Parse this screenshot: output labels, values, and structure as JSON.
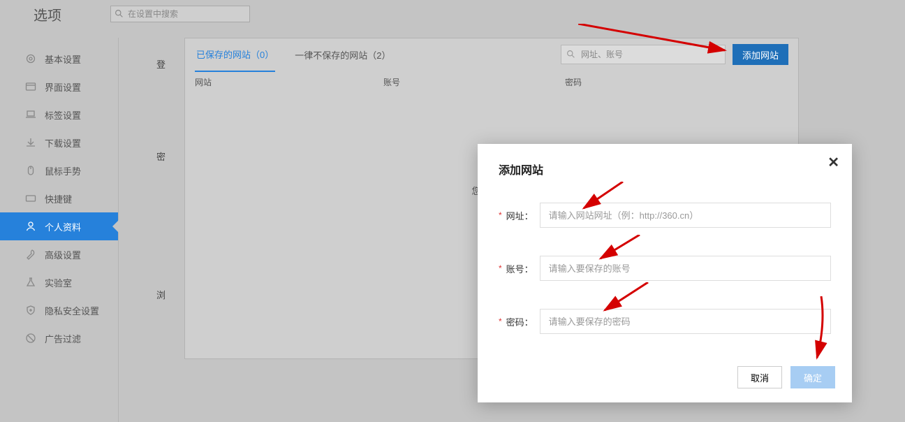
{
  "header": {
    "title": "选项",
    "search_placeholder": "在设置中搜索"
  },
  "sidebar": {
    "items": [
      {
        "label": "基本设置"
      },
      {
        "label": "界面设置"
      },
      {
        "label": "标签设置"
      },
      {
        "label": "下载设置"
      },
      {
        "label": "鼠标手势"
      },
      {
        "label": "快捷键"
      },
      {
        "label": "个人资料"
      },
      {
        "label": "高级设置"
      },
      {
        "label": "实验室"
      },
      {
        "label": "隐私安全设置"
      },
      {
        "label": "广告过滤"
      }
    ]
  },
  "sections": {
    "login": "登",
    "password": "密",
    "browse": "浏"
  },
  "tabs": {
    "saved": "已保存的网站（0）",
    "never": "一律不保存的网站（2）",
    "filter_placeholder": "网址、账号",
    "add_button": "添加网站"
  },
  "table": {
    "col_site": "网站",
    "col_account": "账号",
    "col_password": "密码",
    "empty_msg": "您保存过的密码将会"
  },
  "modal": {
    "title": "添加网站",
    "url_label": "网址：",
    "url_placeholder": "请输入网站网址（例：http://360.cn）",
    "account_label": "账号：",
    "account_placeholder": "请输入要保存的账号",
    "password_label": "密码：",
    "password_placeholder": "请输入要保存的密码",
    "cancel": "取消",
    "confirm": "确定",
    "required_mark": "*"
  }
}
